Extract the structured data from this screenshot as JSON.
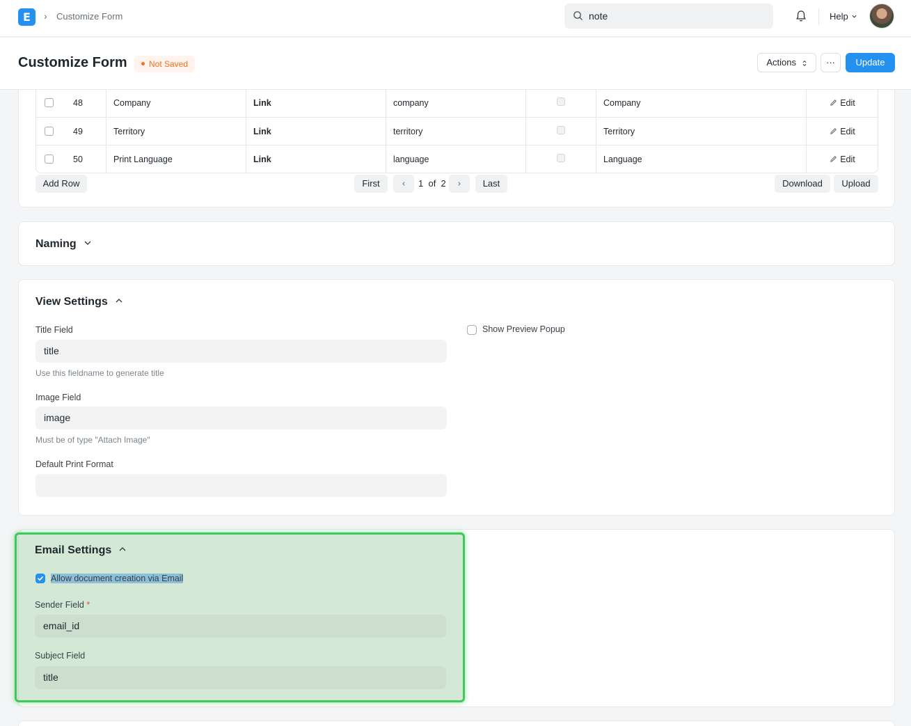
{
  "navbar": {
    "breadcrumb": "Customize Form",
    "search_value": "note",
    "help_label": "Help"
  },
  "page": {
    "title": "Customize Form",
    "status": "Not Saved",
    "actions_label": "Actions",
    "more_label": "···",
    "update_label": "Update"
  },
  "grid": {
    "rows": [
      {
        "idx": "48",
        "label": "Company",
        "type": "Link",
        "fieldname": "company",
        "options": "Company",
        "edit": "Edit"
      },
      {
        "idx": "49",
        "label": "Territory",
        "type": "Link",
        "fieldname": "territory",
        "options": "Territory",
        "edit": "Edit"
      },
      {
        "idx": "50",
        "label": "Print Language",
        "type": "Link",
        "fieldname": "language",
        "options": "Language",
        "edit": "Edit"
      }
    ],
    "add_row": "Add Row",
    "first": "First",
    "page_current": "1",
    "page_of": "of",
    "page_total": "2",
    "last": "Last",
    "download": "Download",
    "upload": "Upload"
  },
  "naming": {
    "title": "Naming"
  },
  "view_settings": {
    "title": "View Settings",
    "title_field_label": "Title Field",
    "title_field_value": "title",
    "title_field_help": "Use this fieldname to generate title",
    "image_field_label": "Image Field",
    "image_field_value": "image",
    "image_field_help": "Must be of type \"Attach Image\"",
    "print_format_label": "Default Print Format",
    "print_format_value": "",
    "preview_popup_label": "Show Preview Popup"
  },
  "email_settings": {
    "title": "Email Settings",
    "allow_label": "Allow document creation via Email",
    "sender_label": "Sender Field",
    "sender_required": "*",
    "sender_value": "email_id",
    "subject_label": "Subject Field",
    "subject_value": "title"
  },
  "colors": {
    "primary": "#2490ef",
    "status_orange": "#f2711c",
    "highlight_green": "#40c85a"
  }
}
